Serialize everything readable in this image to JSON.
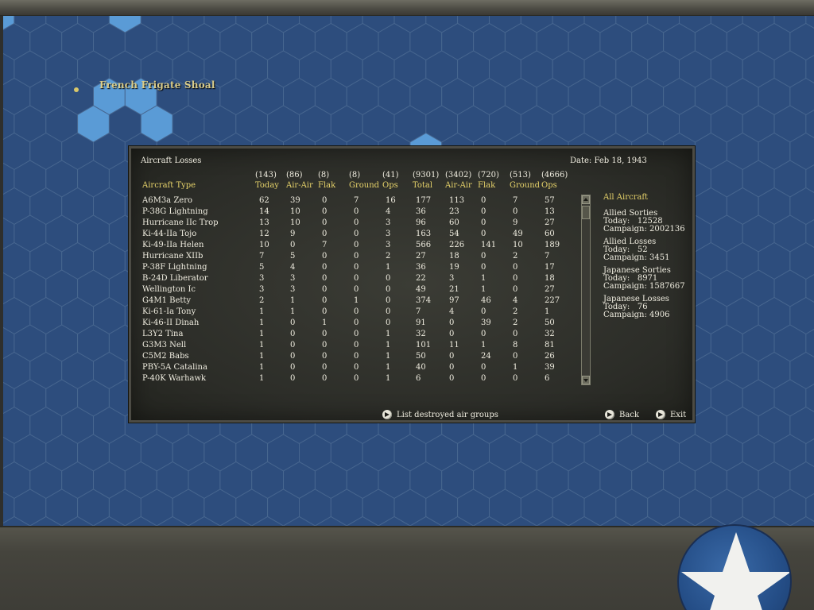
{
  "map": {
    "location_label": "French Frigate Shoal"
  },
  "dialog": {
    "title": "Aircraft Losses",
    "date": "Date: Feb 18, 1943",
    "columns": [
      {
        "key": "name",
        "head": "Aircraft Type",
        "total": ""
      },
      {
        "key": "today",
        "head": "Today",
        "total": "(143)"
      },
      {
        "key": "airair",
        "head": "Air-Air",
        "total": "(86)"
      },
      {
        "key": "flak",
        "head": "Flak",
        "total": "(8)"
      },
      {
        "key": "ground",
        "head": "Ground",
        "total": "(8)"
      },
      {
        "key": "ops",
        "head": "Ops",
        "total": "(41)"
      },
      {
        "key": "total",
        "head": "Total",
        "total": "(9301)"
      },
      {
        "key": "c_airair",
        "head": "Air-Air",
        "total": "(3402)"
      },
      {
        "key": "c_flak",
        "head": "Flak",
        "total": "(720)"
      },
      {
        "key": "c_ground",
        "head": "Ground",
        "total": "(513)"
      },
      {
        "key": "c_ops",
        "head": "Ops",
        "total": "(4666)"
      }
    ],
    "rows": [
      [
        "A6M3a Zero",
        "62",
        "39",
        "0",
        "7",
        "16",
        "177",
        "113",
        "0",
        "7",
        "57"
      ],
      [
        "P-38G Lightning",
        "14",
        "10",
        "0",
        "0",
        "4",
        "36",
        "23",
        "0",
        "0",
        "13"
      ],
      [
        "Hurricane IIc Trop",
        "13",
        "10",
        "0",
        "0",
        "3",
        "96",
        "60",
        "0",
        "9",
        "27"
      ],
      [
        "Ki-44-IIa Tojo",
        "12",
        "9",
        "0",
        "0",
        "3",
        "163",
        "54",
        "0",
        "49",
        "60"
      ],
      [
        "Ki-49-IIa Helen",
        "10",
        "0",
        "7",
        "0",
        "3",
        "566",
        "226",
        "141",
        "10",
        "189"
      ],
      [
        "Hurricane XIIb",
        "7",
        "5",
        "0",
        "0",
        "2",
        "27",
        "18",
        "0",
        "2",
        "7"
      ],
      [
        "P-38F Lightning",
        "5",
        "4",
        "0",
        "0",
        "1",
        "36",
        "19",
        "0",
        "0",
        "17"
      ],
      [
        "B-24D Liberator",
        "3",
        "3",
        "0",
        "0",
        "0",
        "22",
        "3",
        "1",
        "0",
        "18"
      ],
      [
        "Wellington Ic",
        "3",
        "3",
        "0",
        "0",
        "0",
        "49",
        "21",
        "1",
        "0",
        "27"
      ],
      [
        "G4M1 Betty",
        "2",
        "1",
        "0",
        "1",
        "0",
        "374",
        "97",
        "46",
        "4",
        "227"
      ],
      [
        "Ki-61-Ia Tony",
        "1",
        "1",
        "0",
        "0",
        "0",
        "7",
        "4",
        "0",
        "2",
        "1"
      ],
      [
        "Ki-46-II Dinah",
        "1",
        "0",
        "1",
        "0",
        "0",
        "91",
        "0",
        "39",
        "2",
        "50"
      ],
      [
        "L3Y2 Tina",
        "1",
        "0",
        "0",
        "0",
        "1",
        "32",
        "0",
        "0",
        "0",
        "32"
      ],
      [
        "G3M3 Nell",
        "1",
        "0",
        "0",
        "0",
        "1",
        "101",
        "11",
        "1",
        "8",
        "81"
      ],
      [
        "C5M2 Babs",
        "1",
        "0",
        "0",
        "0",
        "1",
        "50",
        "0",
        "24",
        "0",
        "26"
      ],
      [
        "PBY-5A Catalina",
        "1",
        "0",
        "0",
        "0",
        "1",
        "40",
        "0",
        "0",
        "1",
        "39"
      ],
      [
        "P-40K Warhawk",
        "1",
        "0",
        "0",
        "0",
        "1",
        "6",
        "0",
        "0",
        "0",
        "6"
      ]
    ],
    "side": {
      "heading": "All Aircraft",
      "allied_sorties": {
        "label": "Allied Sorties",
        "today": "Today:   12528",
        "campaign": "Campaign: 2002136"
      },
      "allied_losses": {
        "label": "Allied Losses",
        "today": "Today:   52",
        "campaign": "Campaign: 3451"
      },
      "japanese_sorties": {
        "label": "Japanese Sorties",
        "today": "Today:   8971",
        "campaign": "Campaign: 1587667"
      },
      "japanese_losses": {
        "label": "Japanese Losses",
        "today": "Today:   76",
        "campaign": "Campaign: 4906"
      }
    },
    "buttons": {
      "list_destroyed": "List destroyed air groups",
      "back": "Back",
      "exit": "Exit"
    }
  },
  "colors": {
    "ocean": "#2d4d7d",
    "shallow": "#5a9bd6",
    "heading_yellow": "#e6d26a"
  }
}
